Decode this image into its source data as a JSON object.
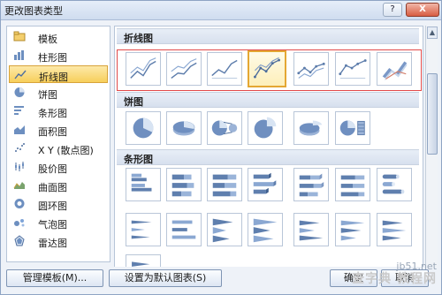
{
  "window": {
    "title": "更改图表类型",
    "help_label": "?",
    "close_label": "X"
  },
  "sidebar": {
    "items": [
      {
        "label": "模板",
        "icon": "folder-icon"
      },
      {
        "label": "柱形图",
        "icon": "column-chart-icon"
      },
      {
        "label": "折线图",
        "icon": "line-chart-icon",
        "selected": true
      },
      {
        "label": "饼图",
        "icon": "pie-chart-icon"
      },
      {
        "label": "条形图",
        "icon": "bar-chart-icon"
      },
      {
        "label": "面积图",
        "icon": "area-chart-icon"
      },
      {
        "label": "X Y (散点图)",
        "icon": "scatter-chart-icon"
      },
      {
        "label": "股价图",
        "icon": "stock-chart-icon"
      },
      {
        "label": "曲面图",
        "icon": "surface-chart-icon"
      },
      {
        "label": "圆环图",
        "icon": "doughnut-chart-icon"
      },
      {
        "label": "气泡图",
        "icon": "bubble-chart-icon"
      },
      {
        "label": "雷达图",
        "icon": "radar-chart-icon"
      }
    ]
  },
  "gallery": {
    "sections": [
      {
        "label": "折线图",
        "key": "line"
      },
      {
        "label": "饼图",
        "key": "pie"
      },
      {
        "label": "条形图",
        "key": "bar"
      }
    ]
  },
  "buttons": {
    "manage_templates": "管理模板(M)...",
    "set_default": "设置为默认图表(S)",
    "ok": "确定",
    "cancel": "取消"
  },
  "watermark": {
    "line1": "jb51.net",
    "line2": "查字典 教程网"
  },
  "accent_colors": {
    "selection_fill": "#f7cf5b",
    "selection_border": "#e4a733",
    "highlight_box": "#e24a4a"
  }
}
